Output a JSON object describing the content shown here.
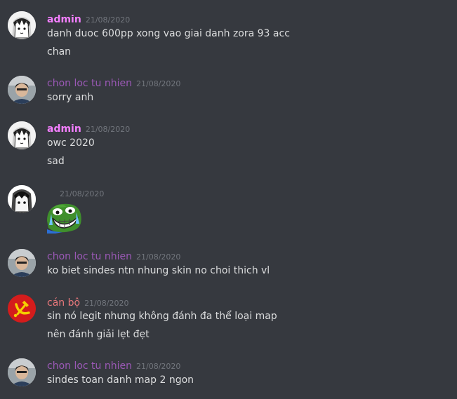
{
  "colors": {
    "admin": "#f47fff",
    "chon": "#9b59b6",
    "canbo": "#e9787b",
    "text": "#dcddde",
    "timestamp": "#72767d",
    "background": "#36393f"
  },
  "messages": [
    {
      "user": "admin",
      "time": "21/08/2020",
      "lines": [
        "danh duoc 600pp xong vao giai danh zora 93 acc",
        "chan"
      ]
    },
    {
      "user": "chon loc tu nhien",
      "time": "21/08/2020",
      "lines": [
        "sorry anh"
      ]
    },
    {
      "user": "admin",
      "time": "21/08/2020",
      "lines": [
        "owc 2020",
        "sad"
      ]
    },
    {
      "user": "",
      "time": "21/08/2020",
      "emoji": "crying-pepe-emoji"
    },
    {
      "user": "chon loc tu nhien",
      "time": "21/08/2020",
      "lines": [
        "ko biet sindes ntn nhung skin no choi thich vl"
      ]
    },
    {
      "user": "cán bộ",
      "time": "21/08/2020",
      "lines": [
        "sin nó legit nhưng không đánh đa thể loại map",
        "nên đánh giải lẹt đẹt"
      ]
    },
    {
      "user": "chon loc tu nhien",
      "time": "21/08/2020",
      "lines": [
        "sindes toan danh map 2 ngon"
      ]
    }
  ]
}
